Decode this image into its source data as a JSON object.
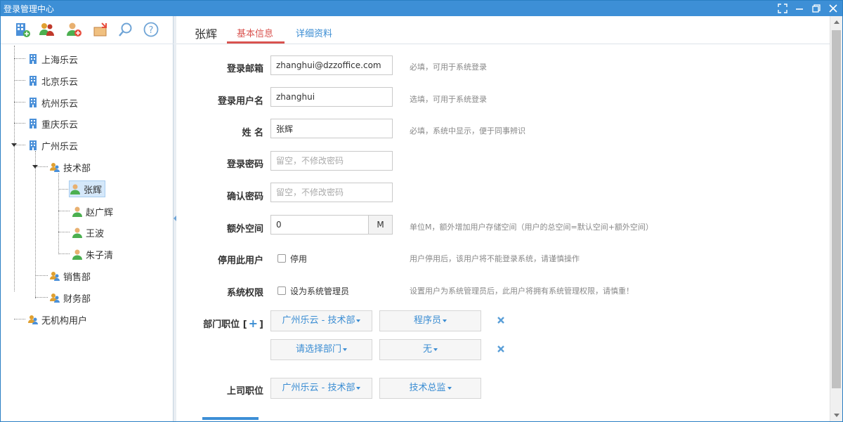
{
  "window": {
    "title": "登录管理中心"
  },
  "colors": {
    "titlebar": "#3d8fd6",
    "accent_blue": "#3b8dd3",
    "active_tab": "#d9534f",
    "selected_bg": "#d5e8fa"
  },
  "toolbar": {
    "icons": [
      "add-org-icon",
      "users-icon",
      "add-user-icon",
      "import-icon",
      "search-icon",
      "help-icon"
    ]
  },
  "tree": {
    "items": [
      {
        "label": "上海乐云",
        "icon": "building-icon"
      },
      {
        "label": "北京乐云",
        "icon": "building-icon"
      },
      {
        "label": "杭州乐云",
        "icon": "building-icon"
      },
      {
        "label": "重庆乐云",
        "icon": "building-icon"
      },
      {
        "label": "广州乐云",
        "icon": "building-icon"
      },
      {
        "label": "技术部",
        "icon": "department-icon"
      },
      {
        "label": "张辉",
        "icon": "user-icon"
      },
      {
        "label": "赵广辉",
        "icon": "user-icon"
      },
      {
        "label": "王波",
        "icon": "user-icon"
      },
      {
        "label": "朱子清",
        "icon": "user-icon"
      },
      {
        "label": "销售部",
        "icon": "department-icon"
      },
      {
        "label": "财务部",
        "icon": "department-icon"
      },
      {
        "label": "无机构用户",
        "icon": "department-icon"
      }
    ]
  },
  "main": {
    "user_name": "张辉",
    "tabs": [
      {
        "label": "基本信息",
        "active": true
      },
      {
        "label": "详细资料",
        "active": false
      }
    ]
  },
  "form": {
    "email": {
      "label": "登录邮箱",
      "value": "zhanghui@dzzoffice.com",
      "hint": "必填，可用于系统登录"
    },
    "username": {
      "label": "登录用户名",
      "value": "zhanghui",
      "hint": "选填，可用于系统登录"
    },
    "name": {
      "label": "姓 名",
      "value": "张辉",
      "hint": "必填，系统中显示，便于同事辨识"
    },
    "password": {
      "label": "登录密码",
      "placeholder": "留空，不修改密码"
    },
    "confirm": {
      "label": "确认密码",
      "placeholder": "留空，不修改密码"
    },
    "space": {
      "label": "额外空间",
      "value": "0",
      "unit": "M",
      "hint": "单位M，额外增加用户存储空间（用户的总空间=默认空间+额外空间）"
    },
    "disable": {
      "label": "停用此用户",
      "checkbox_label": "停用",
      "hint": "用户停用后，该用户将不能登录系统，请谨慎操作"
    },
    "admin": {
      "label": "系统权限",
      "checkbox_label": "设为系统管理员",
      "hint": "设置用户为系统管理员后，此用户将拥有系统管理权限，请慎重！"
    },
    "dept": {
      "label_prefix": "部门职位 [",
      "label_suffix": "]",
      "rows": [
        {
          "dept": "广州乐云 - 技术部",
          "position": "程序员"
        },
        {
          "dept": "请选择部门",
          "position": "无"
        }
      ]
    },
    "superior": {
      "label": "上司职位",
      "dept": "广州乐云 - 技术部",
      "position": "技术总监"
    }
  }
}
